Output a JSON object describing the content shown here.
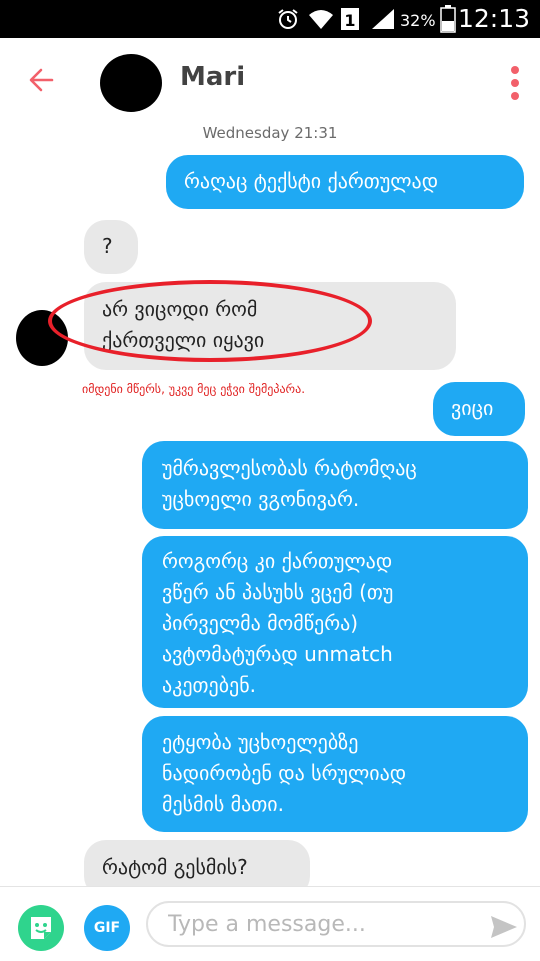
{
  "status_bar": {
    "time": "12:13",
    "battery_percent": "32%",
    "icons": [
      "alarm-icon",
      "wifi-icon",
      "sim-icon",
      "signal-icon",
      "battery-icon"
    ]
  },
  "header": {
    "name": "Mari",
    "back_icon": "back-arrow-icon",
    "menu_icon": "kebab-menu-icon"
  },
  "conversation": {
    "timestamp": "Wednesday 21:31",
    "messages": [
      {
        "from": "me",
        "text": "რაღაც ტექსტი ქართულად"
      },
      {
        "from": "them",
        "text": "?"
      },
      {
        "from": "them",
        "text": "არ ვიცოდი რომ\nქართველი იყავი"
      },
      {
        "from": "me",
        "text": "ვიცი"
      },
      {
        "from": "me",
        "text": "უმრავლესობას რატომღაც\nუცხოელი ვგონივარ."
      },
      {
        "from": "me",
        "text": "როგორც კი ქართულად\nვწერ ან პასუხს ვცემ (თუ\nპირველმა მომწერა)\nავტომატურად unmatch\nაკეთებენ."
      },
      {
        "from": "me",
        "text": "ეტყობა უცხოელებზე\nნადირობენ და სრულიად\nმესმის მათი."
      },
      {
        "from": "them",
        "text": "რატომ გესმის?"
      }
    ],
    "annotation": "იმდენი მწერს, უკვე მეც ეჭვი შემეპარა."
  },
  "composer": {
    "placeholder": "Type a message...",
    "value": "",
    "gif_label": "GIF"
  },
  "colors": {
    "accent": "#f2606a",
    "outgoing_bubble": "#1fa9f3",
    "incoming_bubble": "#e8e8e8",
    "sticker_button": "#2fd48d",
    "annotation": "#e02020"
  }
}
